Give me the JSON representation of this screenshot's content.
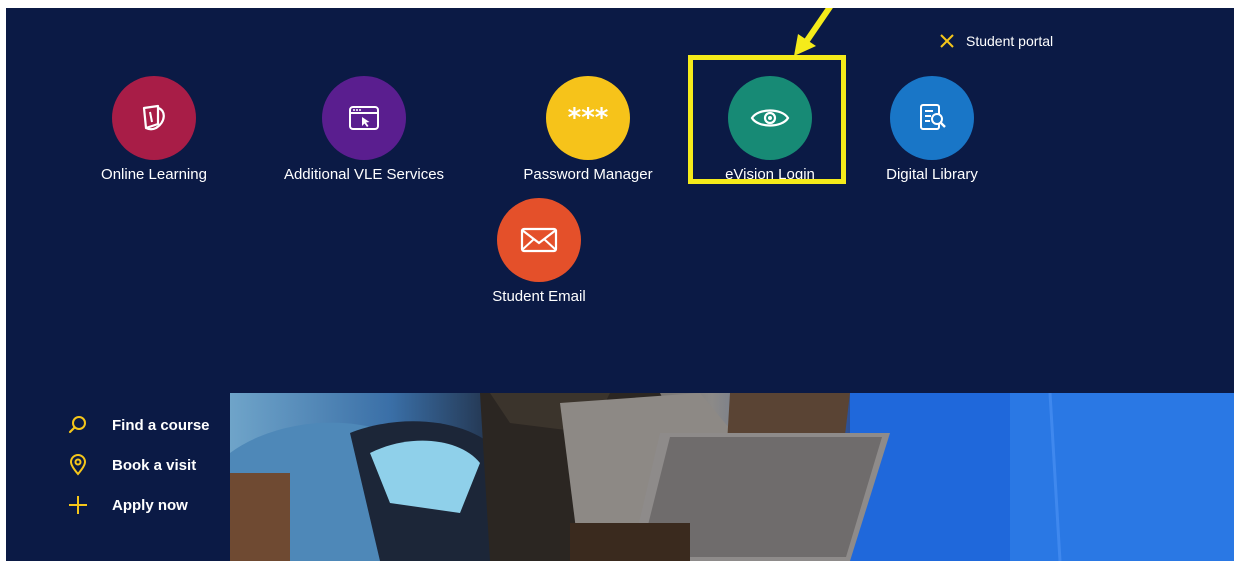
{
  "header": {
    "close_label": "Student portal",
    "close_icon": "close-icon",
    "accent_color": "#f5c61a"
  },
  "tiles": [
    {
      "label": "Online Learning",
      "icon": "pen-book-icon",
      "color": "#a81d47"
    },
    {
      "label": "Additional VLE Services",
      "icon": "browser-cursor-icon",
      "color": "#5a1e8f"
    },
    {
      "label": "Password Manager",
      "icon": "asterisks-icon",
      "color": "#f6c31a"
    },
    {
      "label": "eVision Login",
      "icon": "eye-icon",
      "color": "#178a75"
    },
    {
      "label": "Digital Library",
      "icon": "document-search-icon",
      "color": "#1976c7"
    },
    {
      "label": "Student Email",
      "icon": "envelope-icon",
      "color": "#e4502a"
    }
  ],
  "quick_links": [
    {
      "label": "Find a course",
      "icon": "search-icon"
    },
    {
      "label": "Book a visit",
      "icon": "location-pin-icon"
    },
    {
      "label": "Apply now",
      "icon": "plus-icon"
    }
  ],
  "annotation": {
    "color": "#f5eb1a",
    "icon": "arrow-icon"
  }
}
